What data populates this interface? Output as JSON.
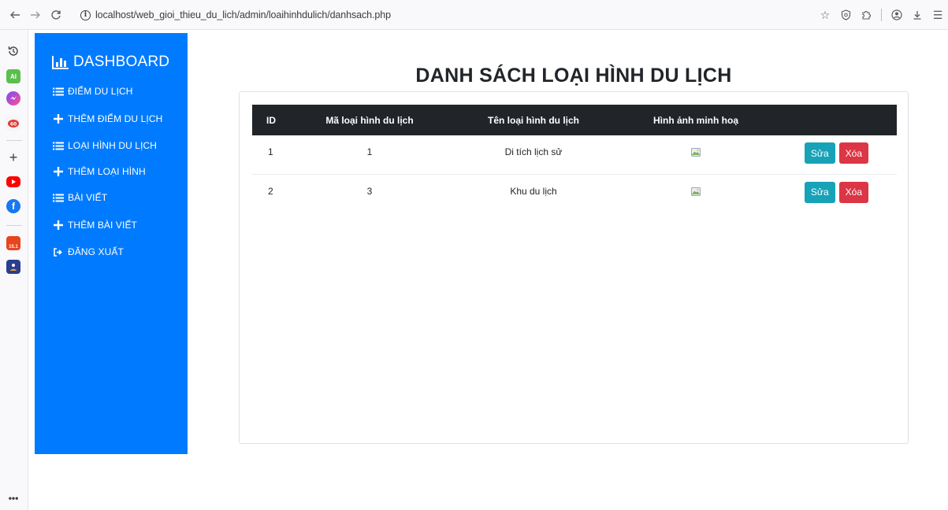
{
  "browser": {
    "url": "localhost/web_gioi_thieu_du_lich/admin/loaihinhdulich/danhsach.php",
    "sidebar_ai_label": "AI",
    "sidebar_badge": "15.1"
  },
  "sidebar": {
    "brand": "DASHBOARD",
    "items": [
      {
        "label": "ĐIỂM DU LỊCH",
        "icon": "list-icon"
      },
      {
        "label": "THÊM ĐIỂM DU LỊCH",
        "icon": "plus-icon"
      },
      {
        "label": "LOẠI HÌNH DU LỊCH",
        "icon": "list-icon"
      },
      {
        "label": "THÊM LOẠI HÌNH",
        "icon": "plus-icon"
      },
      {
        "label": "BÀI VIẾT",
        "icon": "list-icon"
      },
      {
        "label": "THÊM BÀI VIẾT",
        "icon": "plus-icon"
      },
      {
        "label": "ĐĂNG XUẤT",
        "icon": "sign-out-icon"
      }
    ]
  },
  "main": {
    "title": "DANH SÁCH LOẠI HÌNH DU LỊCH",
    "table": {
      "headers": [
        "ID",
        "Mã loại hình du lịch",
        "Tên loại hình du lịch",
        "Hình ảnh minh hoạ",
        ""
      ],
      "rows": [
        {
          "id": "1",
          "code": "1",
          "name": "Di tích lịch sử"
        },
        {
          "id": "2",
          "code": "3",
          "name": "Khu du lịch"
        }
      ],
      "edit_label": "Sửa",
      "delete_label": "Xóa"
    }
  },
  "colors": {
    "sidebar_bg": "#007bff",
    "table_header_bg": "#212529",
    "edit_button": "#17a2b8",
    "delete_button": "#dc3545"
  }
}
